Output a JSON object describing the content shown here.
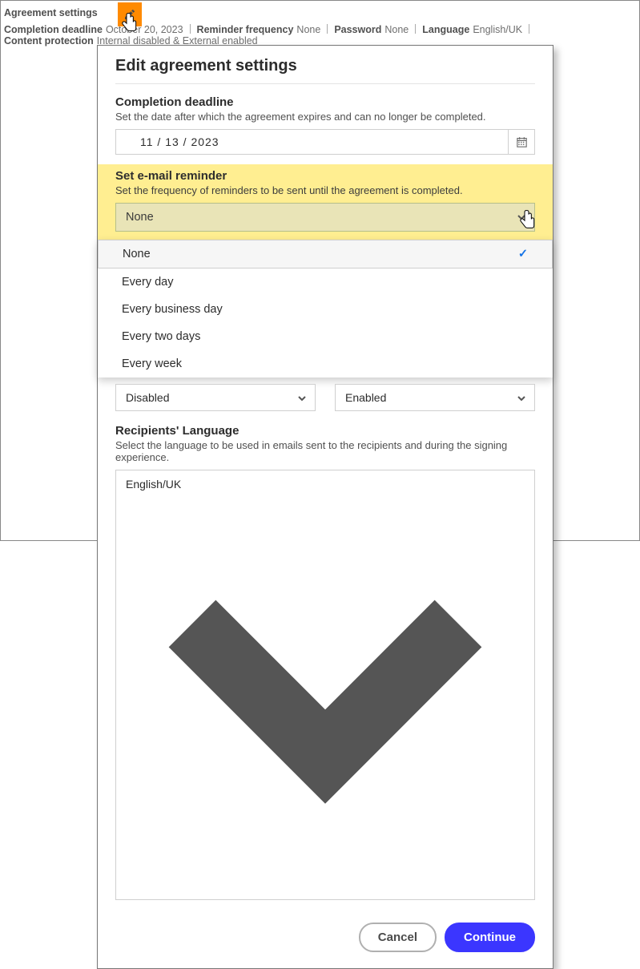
{
  "header": {
    "page_title": "Agreement settings",
    "items": [
      {
        "k": "Completion deadline",
        "v": "October 20, 2023"
      },
      {
        "k": "Reminder frequency",
        "v": "None"
      },
      {
        "k": "Password",
        "v": "None"
      },
      {
        "k": "Language",
        "v": "English/UK"
      },
      {
        "k": "Content protection",
        "v": "Internal disabled & External enabled"
      }
    ]
  },
  "modal": {
    "title": "Edit agreement settings",
    "deadline": {
      "title": "Completion deadline",
      "desc": "Set the date after which the agreement expires and can no longer be completed.",
      "value": "11 / 13 / 2023"
    },
    "reminder": {
      "title": "Set e-mail reminder",
      "desc": "Set the frequency of reminders to be sent until the agreement is completed.",
      "selected": "None",
      "options": [
        "None",
        "Every day",
        "Every business day",
        "Every two days",
        "Every week"
      ]
    },
    "pair": {
      "left": "Disabled",
      "right": "Enabled"
    },
    "language": {
      "title": "Recipients' Language",
      "desc": "Select the language to be used in emails sent to the recipients and during the signing experience.",
      "value": "English/UK"
    },
    "buttons": {
      "cancel": "Cancel",
      "continue": "Continue"
    }
  }
}
